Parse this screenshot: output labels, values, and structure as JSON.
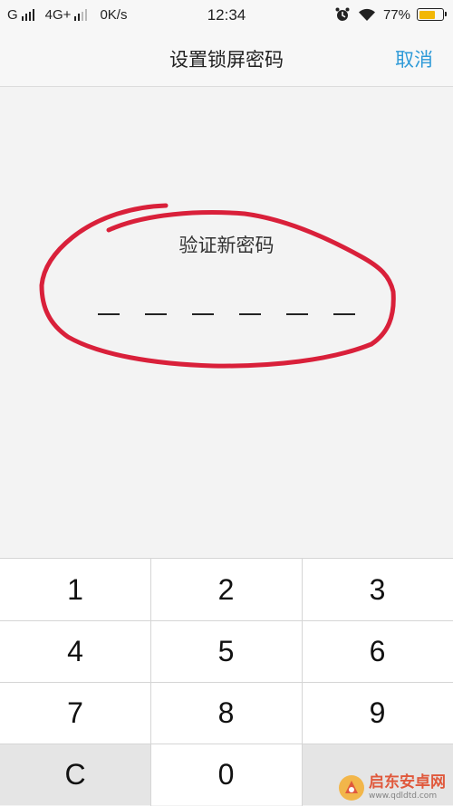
{
  "status_bar": {
    "carrier1": "G",
    "carrier2": "4G+",
    "speed": "0K/s",
    "time": "12:34",
    "battery_percent_text": "77%",
    "battery_level": 0.77,
    "battery_color": "#f2b705",
    "icons": [
      "signal-icon",
      "alarm-icon",
      "wifi-icon",
      "battery-icon"
    ]
  },
  "nav": {
    "title": "设置锁屏密码",
    "cancel_label": "取消",
    "accent_color": "#2e9ad8"
  },
  "prompt": {
    "label": "验证新密码",
    "pin_length": 6
  },
  "annotation": {
    "type": "hand-drawn-circle",
    "color": "#d9203a"
  },
  "keypad": {
    "keys": [
      "1",
      "2",
      "3",
      "4",
      "5",
      "6",
      "7",
      "8",
      "9",
      "C",
      "0",
      ""
    ]
  },
  "watermark": {
    "name": "启东安卓网",
    "url": "www.qdldtd.com"
  }
}
